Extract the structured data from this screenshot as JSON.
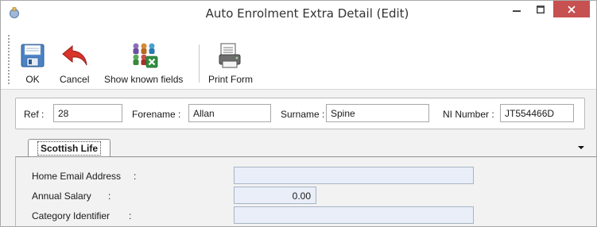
{
  "window": {
    "title": "Auto Enrolment Extra Detail (Edit)",
    "icons": {
      "app": "app-icon",
      "minimize": "minimize-icon",
      "maximize": "maximize-icon",
      "close": "close-icon"
    },
    "close_color": "#c75050"
  },
  "toolbar": {
    "ok_label": "OK",
    "cancel_label": "Cancel",
    "show_known_fields_label": "Show known fields",
    "print_form_label": "Print Form",
    "icons": {
      "ok": "save-floppy-icon",
      "cancel": "undo-arrow-icon",
      "show_known_fields": "people-grid-icon",
      "print_form": "print-form-icon"
    }
  },
  "header": {
    "ref_label": "Ref :",
    "ref_value": "28",
    "forename_label": "Forename :",
    "forename_value": "Allan",
    "surname_label": "Surname :",
    "surname_value": "Spine",
    "ni_label": "NI Number :",
    "ni_value": "JT554466D"
  },
  "tabs": {
    "active_label": "Scottish Life",
    "dropdown_icon": "triangle-down-icon"
  },
  "form": {
    "fields": [
      {
        "label": "Home Email Address",
        "colon": ":",
        "value": ""
      },
      {
        "label": "Annual Salary",
        "colon": ":",
        "value": "0.00"
      },
      {
        "label": "Category Identifier",
        "colon": ":",
        "value": ""
      }
    ],
    "input_background": "#e9eef8"
  }
}
